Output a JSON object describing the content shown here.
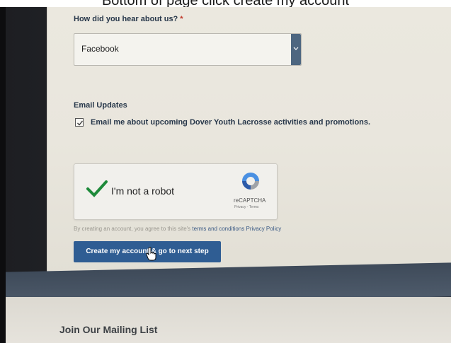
{
  "caption": "Bottom of page click create my account",
  "form": {
    "referral_question": "How did you hear about us?",
    "required_mark": "*",
    "referral_selected": "Facebook",
    "email_section_title": "Email Updates",
    "email_opt_in_label": "Email me about upcoming Dover Youth Lacrosse activities and promotions.",
    "email_opt_in_checked": true
  },
  "recaptcha": {
    "label": "I'm not a robot",
    "brand": "reCAPTCHA",
    "terms": "Privacy - Terms"
  },
  "consent": {
    "prefix": "By creating an account, you agree to this site's",
    "terms_link": "terms and conditions",
    "privacy_link": "Privacy Policy"
  },
  "submit_label": "Create my account & go to next step",
  "footer": {
    "mailing_title": "Join Our Mailing List"
  },
  "colors": {
    "primary_button": "#2f5d93",
    "required": "#c0392b",
    "recaptcha_check": "#1e8a3a"
  }
}
